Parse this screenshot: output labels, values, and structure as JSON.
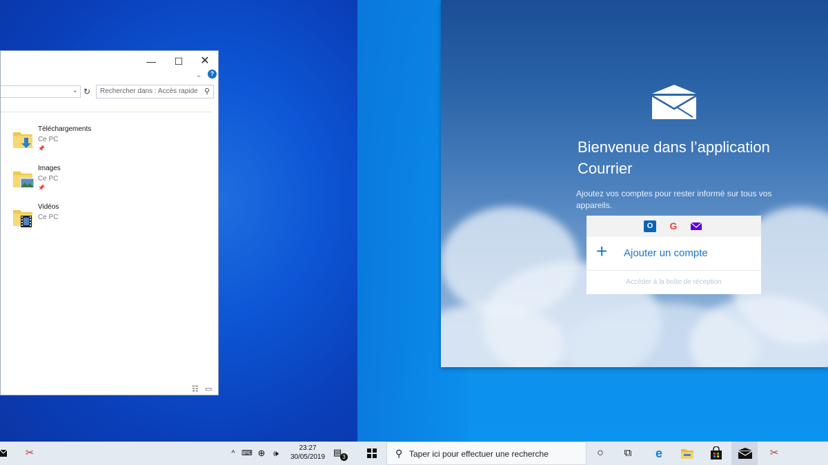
{
  "explorer": {
    "controls": {
      "minimize": "—",
      "maximize": "☐",
      "close": "✕"
    },
    "search_placeholder": "Rechercher dans : Accès rapide",
    "help": "?",
    "items": [
      {
        "name": "Téléchargements",
        "location": "Ce PC",
        "pinned": true
      },
      {
        "name": "Images",
        "location": "Ce PC",
        "pinned": true
      },
      {
        "name": "Vidéos",
        "location": "Ce PC",
        "pinned": false
      }
    ]
  },
  "mail": {
    "title_line1": "Bienvenue dans l’application",
    "title_line2": "Courrier",
    "subtitle": "Ajoutez vos comptes pour rester informé sur tous vos appareils.",
    "providers": [
      "outlook-icon",
      "google-icon",
      "yahoo-icon"
    ],
    "add_account": "Ajouter un compte",
    "inbox_link": "Accéder à la boîte de réception"
  },
  "taskbar": {
    "time": "23:27",
    "date": "30/05/2019",
    "notifications": "3",
    "search_placeholder": "Taper ici pour effectuer une recherche"
  },
  "colors": {
    "accent": "#1a75cf",
    "desktop_left": "#0d56d6",
    "desktop_right": "#0c93ef",
    "taskbar": "#e3eaf2"
  }
}
